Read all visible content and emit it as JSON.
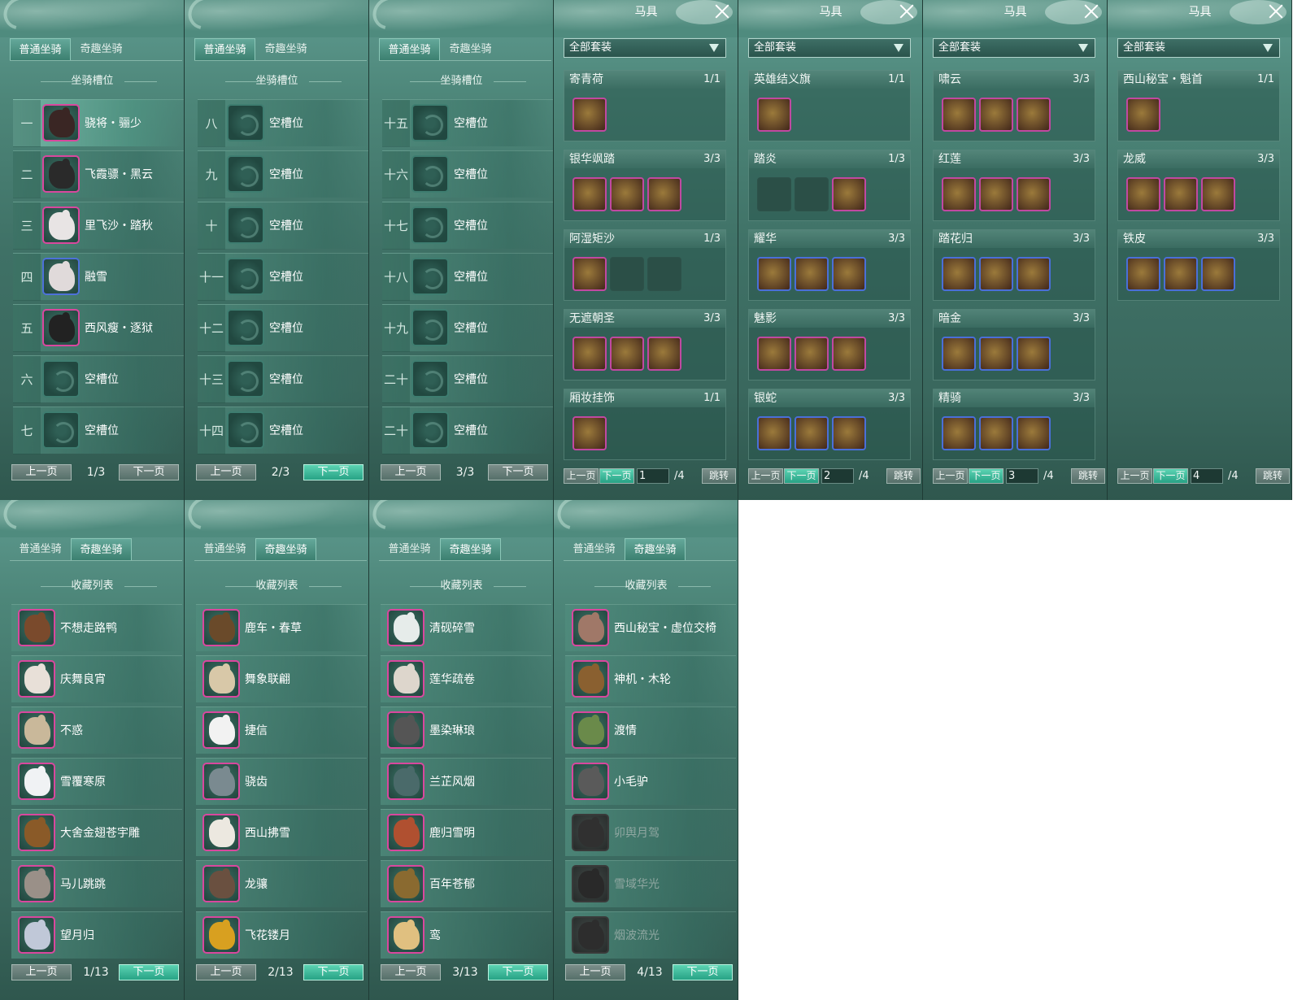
{
  "tabs": {
    "normal": "普通坐骑",
    "fun": "奇趣坐骑"
  },
  "slot_title": "坐骑槽位",
  "collection_title": "收藏列表",
  "pager": {
    "prev": "上一页",
    "next": "下一页"
  },
  "harness": {
    "title": "马具",
    "filter": "全部套装",
    "prev": "上一页",
    "next": "下一页",
    "jump": "跳转",
    "total": "/4"
  },
  "slot_pages": [
    {
      "page": "1/3",
      "rows": [
        {
          "num": "一",
          "name": "骁将・骊少",
          "frame": "pink",
          "color": "#3a2624"
        },
        {
          "num": "二",
          "name": "飞霞骠・黑云",
          "frame": "pink",
          "color": "#2a2a2a"
        },
        {
          "num": "三",
          "name": "里飞沙・踏秋",
          "frame": "pink",
          "color": "#e8e4e4"
        },
        {
          "num": "四",
          "name": "融雪",
          "frame": "blue",
          "color": "#e0dada"
        },
        {
          "num": "五",
          "name": "西风瘦・逐狱",
          "frame": "pink",
          "color": "#222222"
        },
        {
          "num": "六",
          "name": "空槽位",
          "frame": "empty"
        },
        {
          "num": "七",
          "name": "空槽位",
          "frame": "empty"
        }
      ]
    },
    {
      "page": "2/3",
      "rows": [
        {
          "num": "八",
          "name": "空槽位",
          "frame": "empty"
        },
        {
          "num": "九",
          "name": "空槽位",
          "frame": "empty"
        },
        {
          "num": "十",
          "name": "空槽位",
          "frame": "empty"
        },
        {
          "num": "十一",
          "name": "空槽位",
          "frame": "empty"
        },
        {
          "num": "十二",
          "name": "空槽位",
          "frame": "empty"
        },
        {
          "num": "十三",
          "name": "空槽位",
          "frame": "empty"
        },
        {
          "num": "十四",
          "name": "空槽位",
          "frame": "empty"
        }
      ]
    },
    {
      "page": "3/3",
      "rows": [
        {
          "num": "十五",
          "name": "空槽位",
          "frame": "empty"
        },
        {
          "num": "十六",
          "name": "空槽位",
          "frame": "empty"
        },
        {
          "num": "十七",
          "name": "空槽位",
          "frame": "empty"
        },
        {
          "num": "十八",
          "name": "空槽位",
          "frame": "empty"
        },
        {
          "num": "十九",
          "name": "空槽位",
          "frame": "empty"
        },
        {
          "num": "二十",
          "name": "空槽位",
          "frame": "empty"
        },
        {
          "num": "二十",
          "name": "空槽位",
          "frame": "empty"
        }
      ]
    }
  ],
  "harness_pages": [
    {
      "page": "1",
      "sets": [
        {
          "name": "寄青荷",
          "count": "1/1",
          "pieces": [
            "pink"
          ]
        },
        {
          "name": "银华飒踏",
          "count": "3/3",
          "pieces": [
            "pink",
            "pink",
            "pink"
          ]
        },
        {
          "name": "阿湿矩沙",
          "count": "1/3",
          "pieces": [
            "pink",
            "empty",
            "empty"
          ]
        },
        {
          "name": "无遮朝圣",
          "count": "3/3",
          "pieces": [
            "pink",
            "pink",
            "pink"
          ]
        },
        {
          "name": "厢妆挂饰",
          "count": "1/1",
          "pieces": [
            "pink"
          ]
        }
      ]
    },
    {
      "page": "2",
      "sets": [
        {
          "name": "英雄结义旗",
          "count": "1/1",
          "pieces": [
            "pink"
          ]
        },
        {
          "name": "踏炎",
          "count": "1/3",
          "pieces": [
            "empty",
            "empty",
            "pink"
          ]
        },
        {
          "name": "耀华",
          "count": "3/3",
          "pieces": [
            "blue",
            "blue",
            "blue"
          ]
        },
        {
          "name": "魅影",
          "count": "3/3",
          "pieces": [
            "pink",
            "pink",
            "pink"
          ]
        },
        {
          "name": "银蛇",
          "count": "3/3",
          "pieces": [
            "blue",
            "blue",
            "blue"
          ]
        }
      ]
    },
    {
      "page": "3",
      "sets": [
        {
          "name": "啸云",
          "count": "3/3",
          "pieces": [
            "pink",
            "pink",
            "pink"
          ]
        },
        {
          "name": "红莲",
          "count": "3/3",
          "pieces": [
            "pink",
            "pink",
            "pink"
          ]
        },
        {
          "name": "踏花归",
          "count": "3/3",
          "pieces": [
            "blue",
            "blue",
            "blue"
          ]
        },
        {
          "name": "暗金",
          "count": "3/3",
          "pieces": [
            "blue",
            "blue",
            "blue"
          ]
        },
        {
          "name": "精骑",
          "count": "3/3",
          "pieces": [
            "blue",
            "blue",
            "blue"
          ]
        }
      ]
    },
    {
      "page": "4",
      "sets": [
        {
          "name": "西山秘宝・魁首",
          "count": "1/1",
          "pieces": [
            "pink"
          ]
        },
        {
          "name": "龙威",
          "count": "3/3",
          "pieces": [
            "pink",
            "pink",
            "pink"
          ]
        },
        {
          "name": "铁皮",
          "count": "3/3",
          "pieces": [
            "blue",
            "blue",
            "blue"
          ]
        }
      ]
    }
  ],
  "collection_pages": [
    {
      "page": "1/13",
      "rows": [
        {
          "name": "不想走路鸭",
          "frame": "pink",
          "color": "#7a4a2c"
        },
        {
          "name": "庆舞良宵",
          "frame": "pink",
          "color": "#e8e0d8"
        },
        {
          "name": "不惑",
          "frame": "pink",
          "color": "#c9b89a"
        },
        {
          "name": "雪覆寒原",
          "frame": "pink",
          "color": "#f0f2f4"
        },
        {
          "name": "大舍金翅苍宇雕",
          "frame": "pink",
          "color": "#8a5a28"
        },
        {
          "name": "马儿跳跳",
          "frame": "pink",
          "color": "#9a9088"
        },
        {
          "name": "望月归",
          "frame": "pink",
          "color": "#c0c8d8"
        }
      ]
    },
    {
      "page": "2/13",
      "rows": [
        {
          "name": "鹿车・春草",
          "frame": "pink",
          "color": "#6a4a2a"
        },
        {
          "name": "舞象联翩",
          "frame": "pink",
          "color": "#d8c8a8"
        },
        {
          "name": "捷信",
          "frame": "pink",
          "color": "#f2f2f2"
        },
        {
          "name": "骁齿",
          "frame": "pink",
          "color": "#7a8a90"
        },
        {
          "name": "西山拂雪",
          "frame": "pink",
          "color": "#ece8e0"
        },
        {
          "name": "龙骧",
          "frame": "pink",
          "color": "#6a5040"
        },
        {
          "name": "飞花镂月",
          "frame": "pink",
          "color": "#d8a020"
        }
      ]
    },
    {
      "page": "3/13",
      "rows": [
        {
          "name": "清砚碎雪",
          "frame": "pink",
          "color": "#e6ecea"
        },
        {
          "name": "莲华疏卷",
          "frame": "pink",
          "color": "#ddd6cc"
        },
        {
          "name": "墨染琳琅",
          "frame": "pink",
          "color": "#555555"
        },
        {
          "name": "兰芷风烟",
          "frame": "pink",
          "color": "#4a6a6a"
        },
        {
          "name": "鹿归雪明",
          "frame": "pink",
          "color": "#b05030"
        },
        {
          "name": "百年苍郁",
          "frame": "pink",
          "color": "#8a6a30"
        },
        {
          "name": "鸾",
          "frame": "pink",
          "color": "#e0c080"
        }
      ]
    },
    {
      "page": "4/13",
      "rows": [
        {
          "name": "西山秘宝・虚位交椅",
          "frame": "pink",
          "color": "#a07868",
          "dim": false
        },
        {
          "name": "神机・木轮",
          "frame": "pink",
          "color": "#8a6030",
          "dim": false
        },
        {
          "name": "渡情",
          "frame": "pink",
          "color": "#6a8a4a",
          "dim": false
        },
        {
          "name": "小毛驴",
          "frame": "pink",
          "color": "#5a5a5a",
          "dim": false
        },
        {
          "name": "卯舆月驾",
          "frame": "gray",
          "color": "#444444",
          "dim": true
        },
        {
          "name": "雪域华光",
          "frame": "gray",
          "color": "#3a3a3a",
          "dim": true
        },
        {
          "name": "烟波流光",
          "frame": "gray",
          "color": "#404040",
          "dim": true
        }
      ]
    }
  ]
}
